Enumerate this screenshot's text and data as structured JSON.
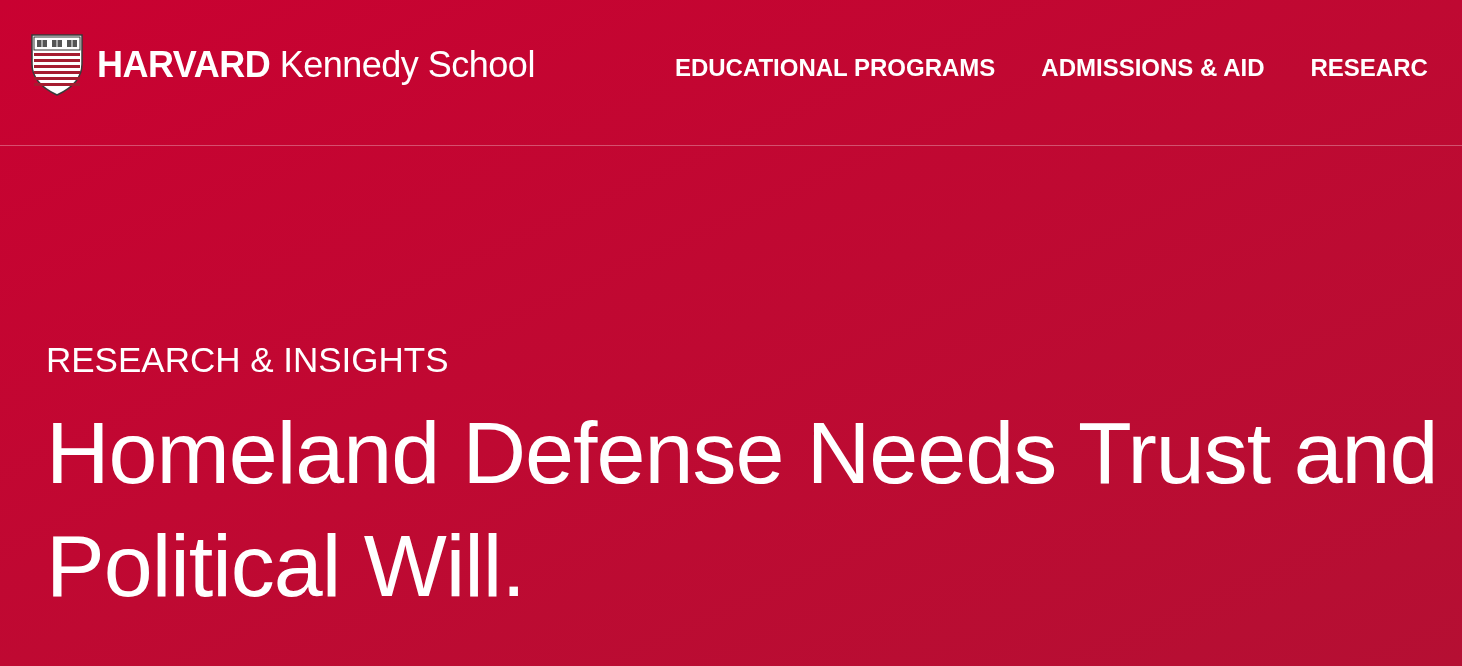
{
  "header": {
    "logo": {
      "wordmark": "**HARVARD** Kennedy School"
    },
    "nav": [
      {
        "label": "EDUCATIONAL PROGRAMS"
      },
      {
        "label": "ADMISSIONS & AID"
      },
      {
        "label": "RESEARC"
      }
    ]
  },
  "hero": {
    "eyebrow": "RESEARCH & INSIGHTS",
    "title": "Homeland Defense Needs Trust and Political Will."
  }
}
